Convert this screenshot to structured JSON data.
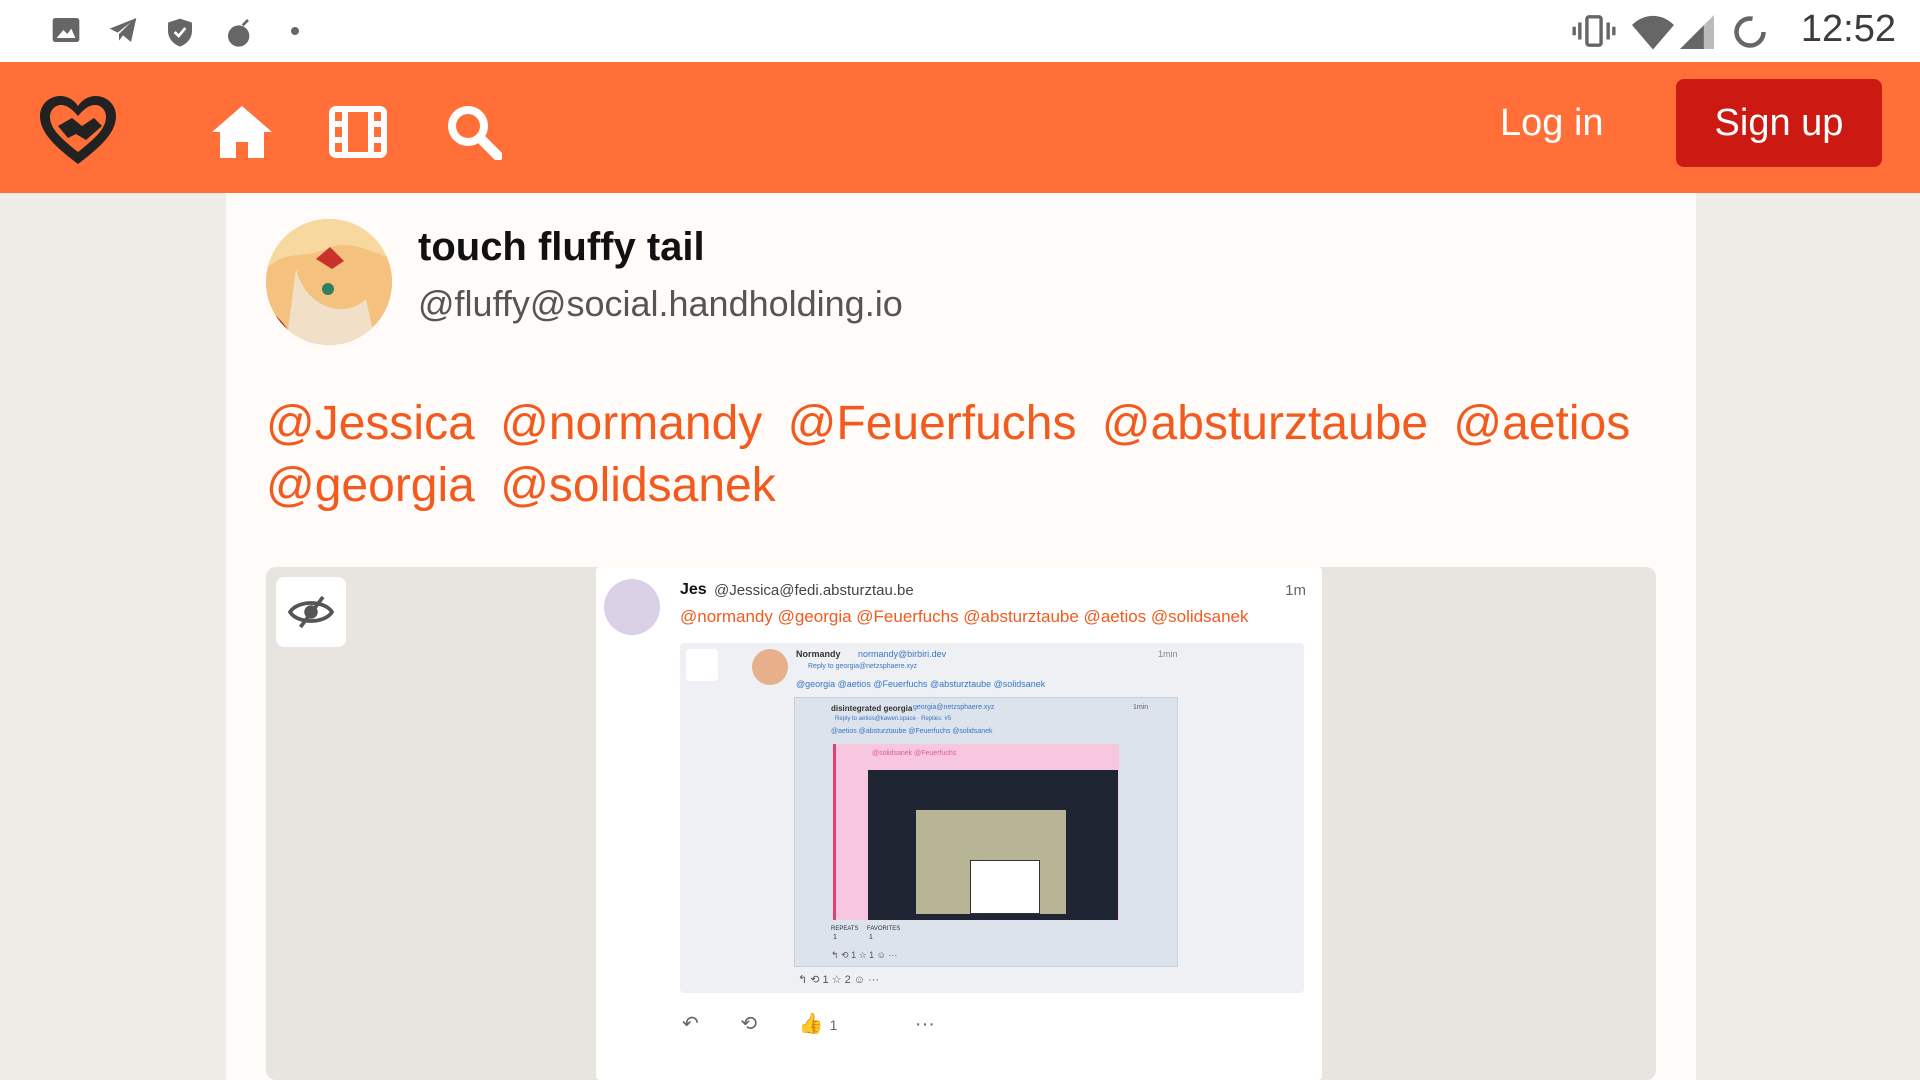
{
  "status_bar": {
    "time": "12:52",
    "left_icons": [
      "image-icon",
      "telegram-icon",
      "shield-check-icon",
      "bomb-icon",
      "dot-icon"
    ],
    "right_icons": [
      "vibrate-icon",
      "wifi-icon",
      "cell-signal-icon",
      "sync-circle-icon"
    ]
  },
  "navbar": {
    "login_label": "Log in",
    "signup_label": "Sign up",
    "colors": {
      "bar": "#ff6f37",
      "signup": "#cc1a12"
    }
  },
  "post": {
    "display_name": "touch fluffy tail",
    "handle": "@fluffy@social.handholding.io",
    "mentions": [
      "@Jessica",
      "@normandy",
      "@Feuerfuchs",
      "@absturztaube",
      "@aetios",
      "@georgia",
      "@solidsanek"
    ]
  },
  "attachment": {
    "name": "Jes",
    "handle": "@Jessica@fedi.absturztau.be",
    "time": "1m",
    "mentions": "@normandy @georgia @Feuerfuchs @absturztaube @aetios @solidsanek",
    "inner": {
      "name": "Normandy",
      "handle": "normandy@birbiri.dev",
      "reply_to": "Reply to georgia@netzsphaere.xyz",
      "mentions": "@georgia @aetios @Feuerfuchs @absturztaube @solidsanek",
      "time": "1min",
      "quoted_name": "disintegrated georgia",
      "quoted_handle": "georgia@netzsphaere.xyz",
      "quoted_time": "1min",
      "quoted_reply": "Reply to aetios@kawen.space · Replies: #5",
      "quoted_mentions": "@aetios @absturztaube @Feuerfuchs @solidsanek",
      "pink_mentions": "@solidsanek @Feuerfuchs",
      "repeats_label": "REPEATS",
      "repeats": "1",
      "favorites_label": "FAVORITES",
      "favorites": "1",
      "actions": "↰    ⟲ 1    ☆ 1    ☺    ···",
      "bottom_actions": "↰    ⟲ 1    ☆ 2    ☺    ···"
    },
    "actions": {
      "reply": "↶",
      "repeat": "⟲",
      "like": "👍",
      "like_count": "1",
      "more": "···"
    }
  }
}
